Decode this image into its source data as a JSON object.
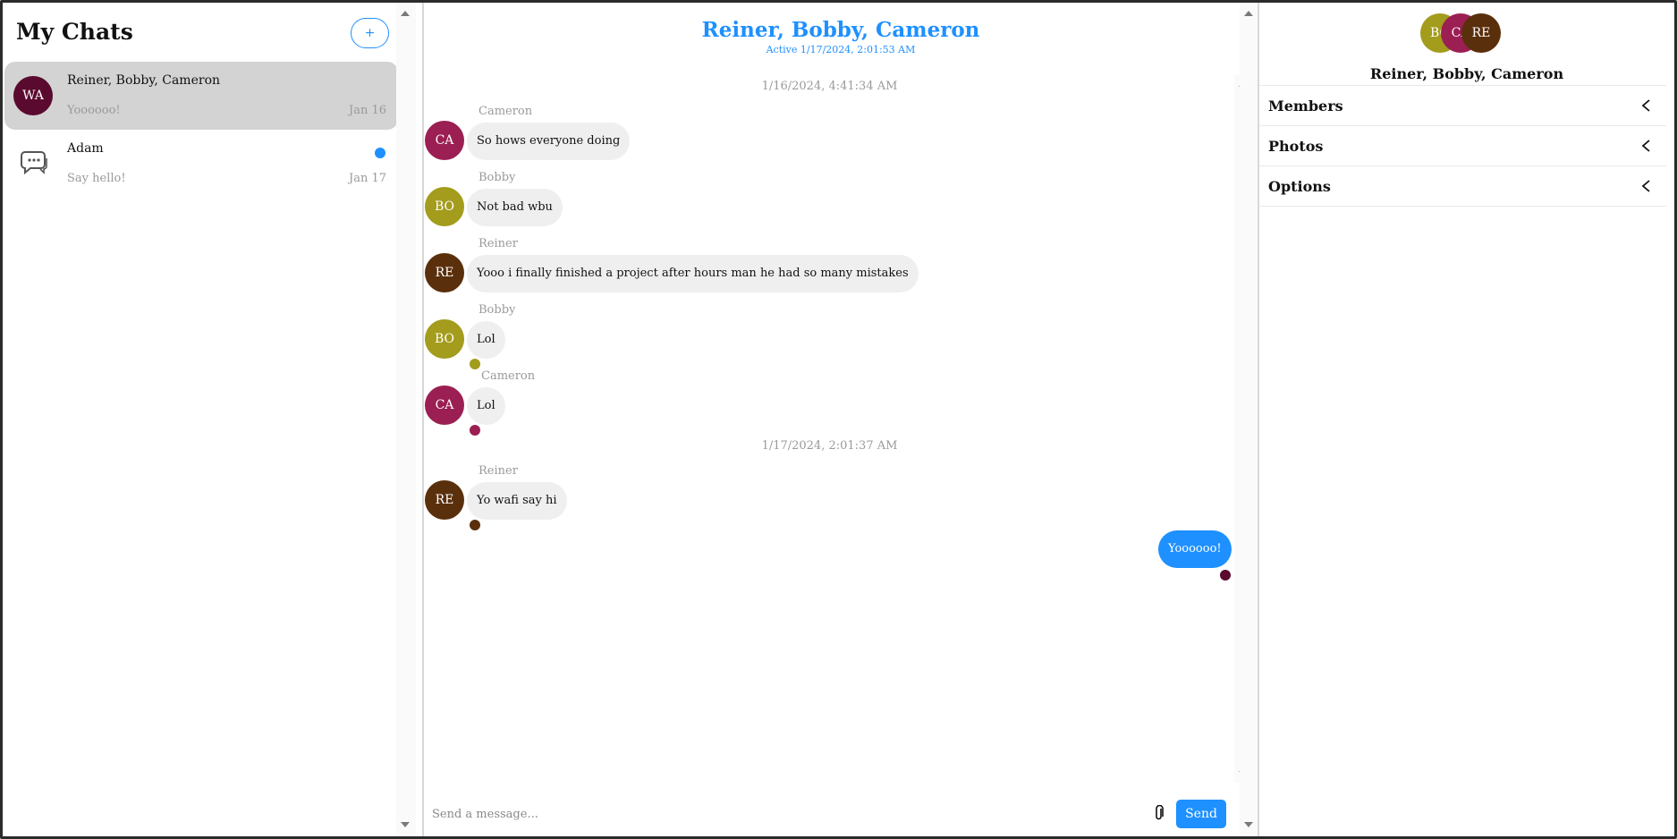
{
  "sidebar": {
    "title": "My Chats",
    "new_button": "+",
    "chats": [
      {
        "avatar": "WA",
        "avatar_color": "#5a0a2e",
        "name": "Reiner, Bobby, Cameron",
        "preview": "Yoooooo!",
        "date": "Jan 16",
        "active": true,
        "unread": false
      },
      {
        "avatar_icon": "chat-bubbles-icon",
        "name": "Adam",
        "preview": "Say hello!",
        "date": "Jan 17",
        "active": false,
        "unread": true
      }
    ]
  },
  "conversation": {
    "title": "Reiner, Bobby, Cameron",
    "status": "Active 1/17/2024, 2:01:53 AM",
    "timestamps": [
      "1/16/2024, 4:41:34 AM",
      "1/17/2024, 2:01:37 AM"
    ],
    "messages": [
      {
        "sender": "Cameron",
        "initials": "CA",
        "color": "#9b1f52",
        "text": "So hows everyone doing"
      },
      {
        "sender": "Bobby",
        "initials": "BO",
        "color": "#a39c1c",
        "text": "Not bad wbu"
      },
      {
        "sender": "Reiner",
        "initials": "RE",
        "color": "#5a2f0c",
        "text": "Yooo i finally finished a project after hours man he had so many mistakes"
      },
      {
        "sender": "Bobby",
        "initials": "BO",
        "color": "#a39c1c",
        "text": "Lol"
      },
      {
        "sender": "Cameron",
        "initials": "CA",
        "color": "#9b1f52",
        "text": "Lol"
      },
      {
        "sender": "Reiner",
        "initials": "RE",
        "color": "#5a2f0c",
        "text": "Yo wafi say hi"
      },
      {
        "sender": "me",
        "text": "Yoooooo!"
      }
    ],
    "composer_placeholder": "Send a message...",
    "send_label": "Send"
  },
  "details": {
    "avatars": [
      {
        "initials": "BO",
        "color": "#a39c1c"
      },
      {
        "initials": "CA",
        "color": "#9b1f52"
      },
      {
        "initials": "RE",
        "color": "#5a2f0c"
      }
    ],
    "group_name": "Reiner, Bobby, Cameron",
    "sections": [
      "Members",
      "Photos",
      "Options"
    ]
  },
  "colors": {
    "accent": "#1e90ff",
    "bubble": "#efefef",
    "active_chat": "#d3d3d3",
    "me_avatar": "#5a0a2e"
  }
}
